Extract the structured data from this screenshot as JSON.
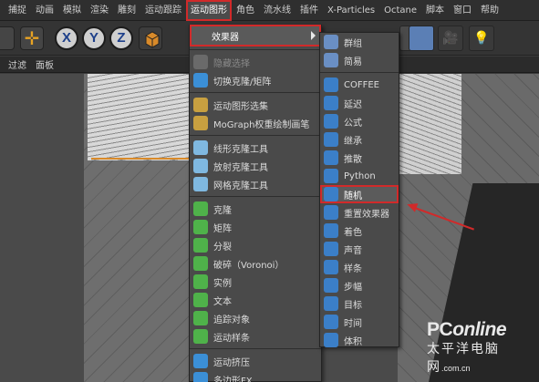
{
  "menubar": {
    "items": [
      "捕捉",
      "动画",
      "模拟",
      "渲染",
      "雕刻",
      "运动跟踪",
      "运动图形",
      "角色",
      "流水线",
      "插件",
      "X-Particles",
      "Octane",
      "脚本",
      "窗口",
      "帮助"
    ]
  },
  "toolbar": {
    "axis_x": "X",
    "axis_y": "Y",
    "axis_z": "Z"
  },
  "subbar": {
    "items": [
      "过滤",
      "面板"
    ]
  },
  "mograph_menu": {
    "effectors_label": "效果器",
    "items": [
      {
        "label": "隐藏选择",
        "icon": "hide-selection-icon",
        "disabled": true
      },
      {
        "label": "切换克隆/矩阵",
        "icon": "toggle-clone-matrix-icon",
        "disabled": false
      },
      {
        "label": "运动图形选集",
        "icon": "mograph-selection-icon",
        "disabled": false
      },
      {
        "label": "MoGraph权重绘制画笔",
        "icon": "weight-paint-brush-icon",
        "disabled": false
      },
      {
        "label": "线形克隆工具",
        "icon": "linear-clone-tool-icon",
        "disabled": false
      },
      {
        "label": "放射克隆工具",
        "icon": "radial-clone-tool-icon",
        "disabled": false
      },
      {
        "label": "网格克隆工具",
        "icon": "grid-clone-tool-icon",
        "disabled": false
      },
      {
        "label": "克隆",
        "icon": "cloner-icon",
        "disabled": false
      },
      {
        "label": "矩阵",
        "icon": "matrix-icon",
        "disabled": false
      },
      {
        "label": "分裂",
        "icon": "fracture-icon",
        "disabled": false
      },
      {
        "label": "破碎（Voronoi）",
        "icon": "voronoi-fracture-icon",
        "disabled": false
      },
      {
        "label": "实例",
        "icon": "instance-icon",
        "disabled": false
      },
      {
        "label": "文本",
        "icon": "text-icon",
        "disabled": false
      },
      {
        "label": "追踪对象",
        "icon": "tracer-icon",
        "disabled": false
      },
      {
        "label": "运动样条",
        "icon": "mospline-icon",
        "disabled": false
      },
      {
        "label": "运动挤压",
        "icon": "moextrude-icon",
        "disabled": false
      },
      {
        "label": "多边形FX",
        "icon": "polyfx-icon",
        "disabled": false
      }
    ]
  },
  "effectors_menu": {
    "items": [
      {
        "label": "群组",
        "icon": "group-icon"
      },
      {
        "label": "简易",
        "icon": "plain-icon"
      },
      {
        "label": "COFFEE",
        "icon": "coffee-icon"
      },
      {
        "label": "延迟",
        "icon": "delay-icon"
      },
      {
        "label": "公式",
        "icon": "formula-icon"
      },
      {
        "label": "继承",
        "icon": "inheritance-icon"
      },
      {
        "label": "推散",
        "icon": "push-apart-icon"
      },
      {
        "label": "Python",
        "icon": "python-icon"
      },
      {
        "label": "随机",
        "icon": "random-icon"
      },
      {
        "label": "重置效果器",
        "icon": "reeffector-icon"
      },
      {
        "label": "着色",
        "icon": "shader-icon"
      },
      {
        "label": "声音",
        "icon": "sound-icon"
      },
      {
        "label": "样条",
        "icon": "spline-icon"
      },
      {
        "label": "步幅",
        "icon": "step-icon"
      },
      {
        "label": "目标",
        "icon": "target-icon"
      },
      {
        "label": "时间",
        "icon": "time-icon"
      },
      {
        "label": "体积",
        "icon": "volume-icon"
      }
    ],
    "highlighted": "随机"
  },
  "watermark": {
    "logo_pc": "PC",
    "logo_online": "online",
    "sub": "太平洋电脑网",
    "domain": ".com.cn"
  },
  "colors": {
    "highlight_red": "#d12a2a",
    "menu_bg": "#4a4a4a",
    "axis_blue": "#1d3f8a"
  }
}
